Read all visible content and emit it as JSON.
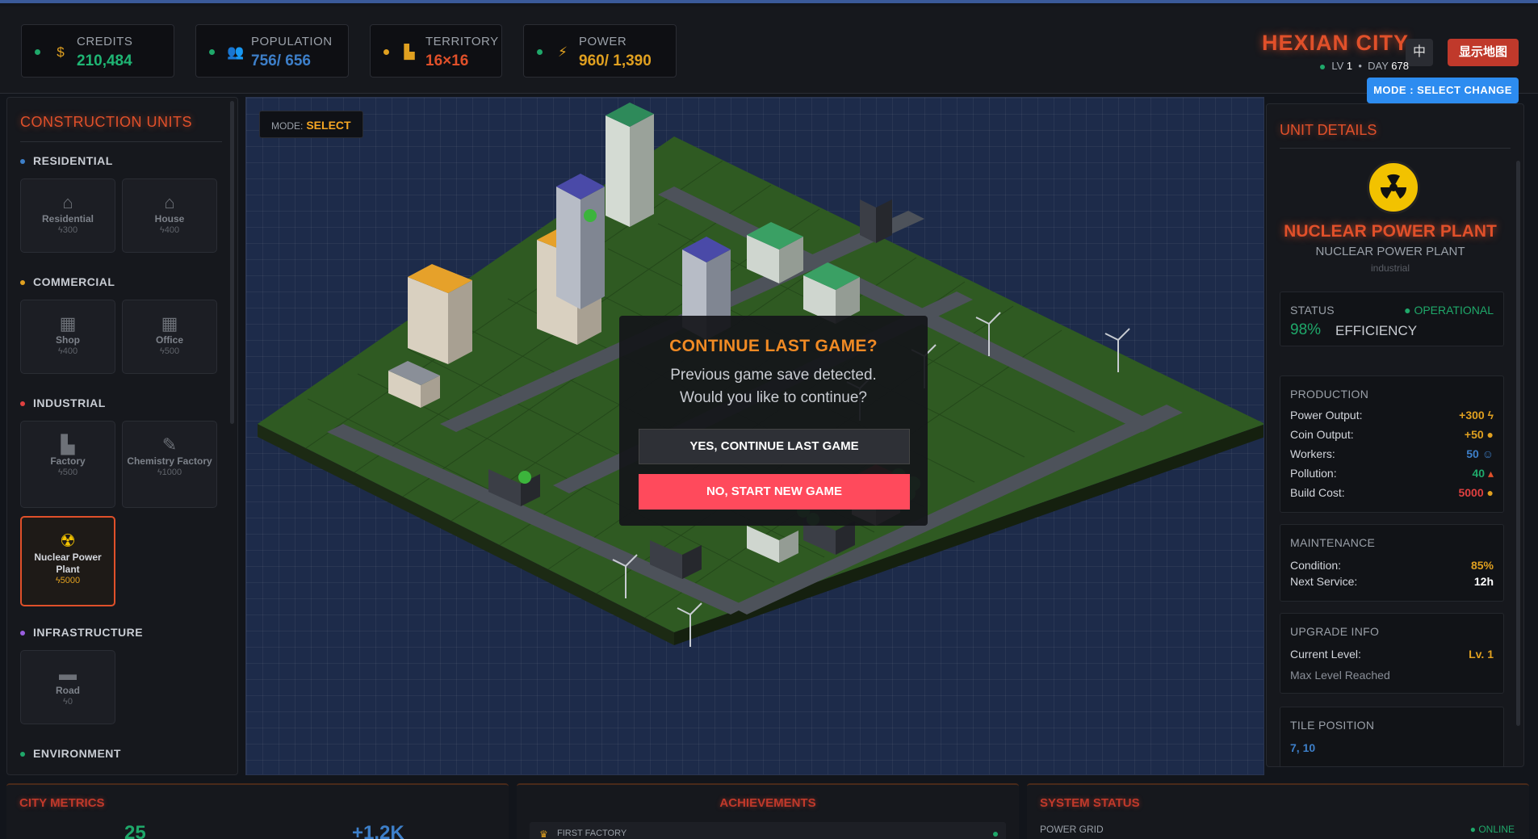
{
  "topbar": {
    "stats": [
      {
        "label": "CREDITS",
        "value": "210,484",
        "color": "#1fb574",
        "icon": "coin-bag-icon"
      },
      {
        "label": "POPULATION",
        "value": "756/ 656",
        "color": "#3d7fc9",
        "icon": "people-icon"
      },
      {
        "label": "TERRITORY",
        "value": "16×16",
        "color": "#e0502a",
        "icon": "factory-icon"
      },
      {
        "label": "POWER",
        "value": "960/ 1,390",
        "color": "#e0a020",
        "icon": "lightning-icon"
      }
    ],
    "city_name": "HEXIAN CITY",
    "lang_label": "中",
    "map_label": "显示地图",
    "lv_label": "LV",
    "lv_value": "1",
    "day_label": "DAY",
    "day_value": "678",
    "mode_button": "MODE : SELECT CHANGE"
  },
  "left": {
    "title": "CONSTRUCTION UNITS",
    "categories": [
      {
        "name": "RESIDENTIAL",
        "color": "#3d7fc9"
      },
      {
        "name": "COMMERCIAL",
        "color": "#e0a020"
      },
      {
        "name": "INDUSTRIAL",
        "color": "#e04040"
      },
      {
        "name": "INFRASTRUCTURE",
        "color": "#9a5fe0"
      },
      {
        "name": "ENVIRONMENT",
        "color": "#1fa86a"
      }
    ],
    "units": [
      {
        "name": "Residential",
        "cost": "300",
        "icon": "house-icon"
      },
      {
        "name": "House",
        "cost": "400",
        "icon": "house-icon"
      },
      {
        "name": "Shop",
        "cost": "400",
        "icon": "shop-icon"
      },
      {
        "name": "Office",
        "cost": "500",
        "icon": "office-icon"
      },
      {
        "name": "Factory",
        "cost": "500",
        "icon": "factory-icon"
      },
      {
        "name": "Chemistry Factory",
        "cost": "1000",
        "icon": "flask-icon"
      },
      {
        "name": "Nuclear Power Plant",
        "cost": "5000",
        "icon": "radiation-icon"
      },
      {
        "name": "Road",
        "cost": "0",
        "icon": "road-icon"
      }
    ]
  },
  "game": {
    "mode_label": "MODE:",
    "mode_value": "SELECT",
    "dialog": {
      "title": "CONTINUE LAST GAME?",
      "message": "Previous game save detected. Would you like to continue?",
      "yes": "YES, CONTINUE LAST GAME",
      "no": "NO, START NEW GAME"
    }
  },
  "details": {
    "title": "UNIT DETAILS",
    "name": "NUCLEAR POWER PLANT",
    "subtitle": "NUCLEAR POWER PLANT",
    "category": "industrial",
    "status_label": "STATUS",
    "status_value": "OPERATIONAL",
    "efficiency_value": "98%",
    "efficiency_label": "EFFICIENCY",
    "production_title": "PRODUCTION",
    "production": [
      {
        "label": "Power Output:",
        "value": "+300",
        "color": "#e0a020"
      },
      {
        "label": "Coin Output:",
        "value": "+50",
        "color": "#e0a020"
      },
      {
        "label": "Workers:",
        "value": "50",
        "color": "#3d7fc9"
      },
      {
        "label": "Pollution:",
        "value": "40",
        "color": "#1fa86a"
      },
      {
        "label": "Build Cost:",
        "value": "5000",
        "color": "#e04040"
      }
    ],
    "maintenance_title": "MAINTENANCE",
    "condition_label": "Condition:",
    "condition_value": "85%",
    "service_label": "Next Service:",
    "service_value": "12h",
    "upgrade_title": "UPGRADE INFO",
    "level_label": "Current Level:",
    "level_value": "Lv. 1",
    "max_level": "Max Level Reached",
    "tile_title": "TILE POSITION",
    "tile_value": "7, 10"
  },
  "bottom": {
    "metrics_title": "CITY METRICS",
    "metrics_v1": "25",
    "metrics_v2": "+1.2K",
    "achievements_title": "ACHIEVEMENTS",
    "achievement_1": "FIRST FACTORY",
    "system_title": "SYSTEM STATUS",
    "power_grid": "POWER GRID",
    "online": "ONLINE"
  }
}
